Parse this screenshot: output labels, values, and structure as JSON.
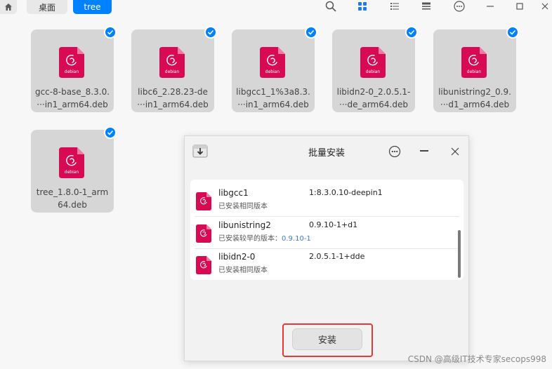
{
  "topbar": {
    "crumbs": [
      "桌面",
      "tree"
    ],
    "icons": [
      "search-icon",
      "icon-view-icon",
      "list-view-icon",
      "detail-view-icon",
      "menu-icon",
      "minimize-icon",
      "maximize-icon",
      "close-icon"
    ]
  },
  "files": [
    {
      "line1": "gcc-8-base_8.3.0.",
      "line2": "···in1_arm64.deb"
    },
    {
      "line1": "libc6_2.28.23-de",
      "line2": "···in1_arm64.deb"
    },
    {
      "line1": "libgcc1_1%3a8.3.",
      "line2": "···in1_arm64.deb"
    },
    {
      "line1": "libidn2-0_2.0.5.1-",
      "line2": "···de_arm64.deb"
    },
    {
      "line1": "libunistring2_0.9.",
      "line2": "···d1_arm64.deb"
    },
    {
      "line1": "tree_1.8.0-1_arm",
      "line2": "64.deb"
    }
  ],
  "icon_label": "debian",
  "dialog": {
    "title": "批量安装",
    "packages": [
      {
        "name": "libgcc1",
        "version": "1:8.3.0.10-deepin1",
        "status": "已安装相同版本",
        "status_version": ""
      },
      {
        "name": "libunistring2",
        "version": "0.9.10-1+d1",
        "status": "已安装较早的版本：",
        "status_version": "0.9.10-1"
      },
      {
        "name": "libidn2-0",
        "version": "2.0.5.1-1+dde",
        "status": "已安装相同版本",
        "status_version": ""
      }
    ],
    "install_label": "安装"
  },
  "watermark": "CSDN @高级IT技术专家secops998",
  "colors": {
    "accent": "#0081ff",
    "debian": "#d70a53",
    "highlight": "#e53935"
  }
}
